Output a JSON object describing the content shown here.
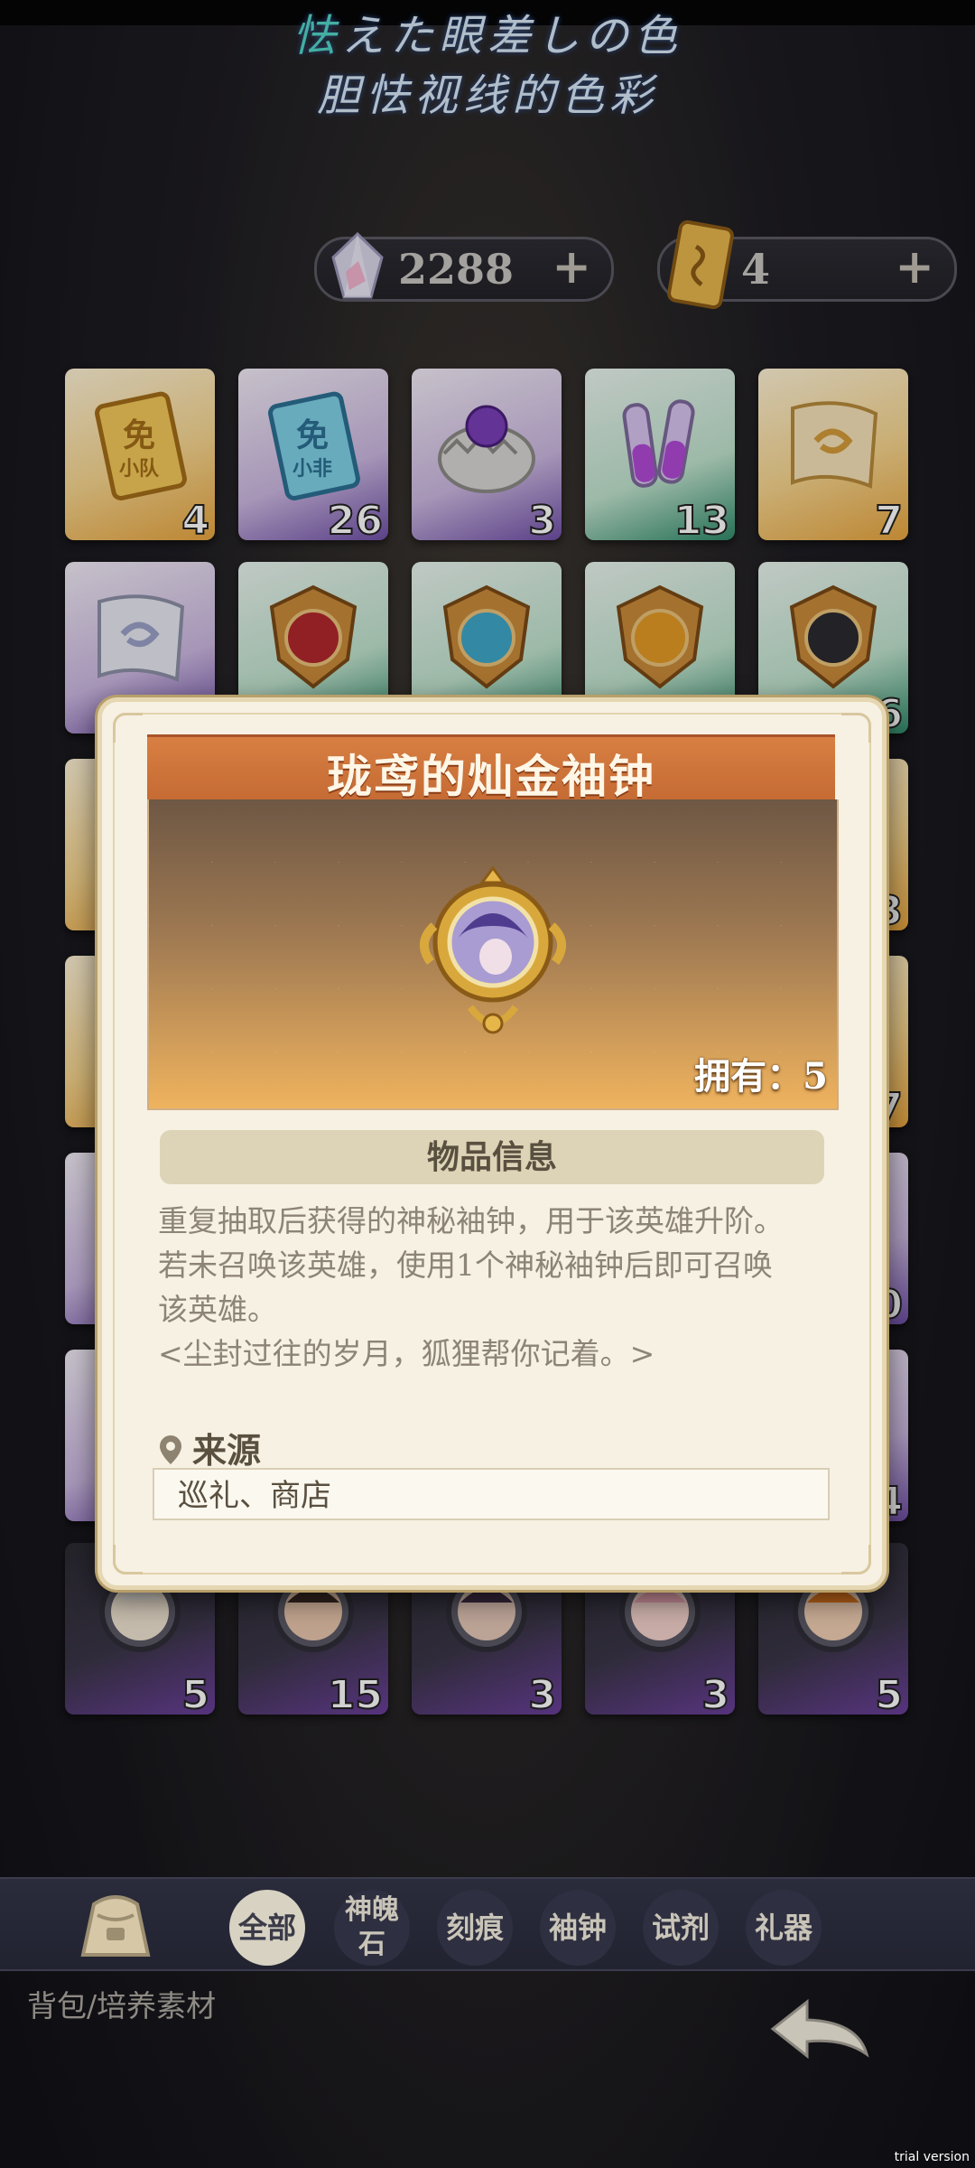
{
  "lyrics": {
    "line1_accent": "怯",
    "line1_rest": "えた眼差しの色",
    "line2": "胆怯视线的色彩"
  },
  "currencies": [
    {
      "name": "crystal",
      "value": "2288",
      "plus": "+"
    },
    {
      "name": "ticket",
      "value": "4",
      "plus": "+"
    }
  ],
  "grid": {
    "row1": [
      {
        "count": "4",
        "rarity": "gold",
        "icon": "ticket-icon",
        "label": "免\n小队"
      },
      {
        "count": "26",
        "rarity": "purple",
        "icon": "ticket-icon",
        "label": "免\n小非"
      },
      {
        "count": "3",
        "rarity": "purple",
        "icon": "egg-icon"
      },
      {
        "count": "13",
        "rarity": "green",
        "icon": "potion-icon"
      },
      {
        "count": "7",
        "rarity": "gold",
        "icon": "scroll-icon"
      }
    ],
    "row2": [
      {
        "count": "",
        "rarity": "purple",
        "icon": "scroll-icon"
      },
      {
        "count": "",
        "rarity": "green",
        "icon": "badge-icon"
      },
      {
        "count": "",
        "rarity": "green",
        "icon": "badge-icon"
      },
      {
        "count": "",
        "rarity": "green",
        "icon": "badge-icon"
      },
      {
        "count": "6",
        "rarity": "green",
        "icon": "badge-icon"
      }
    ],
    "right_counts": [
      "3",
      "7",
      "0",
      "4"
    ],
    "bottom_row": [
      {
        "count": "5",
        "icon": "hero-bell-icon"
      },
      {
        "count": "15",
        "icon": "hero-bell-icon"
      },
      {
        "count": "3",
        "icon": "hero-bell-icon"
      },
      {
        "count": "3",
        "icon": "hero-bell-icon"
      },
      {
        "count": "5",
        "icon": "hero-bell-icon"
      }
    ]
  },
  "modal": {
    "title": "珑鸢的灿金袖钟",
    "owned": "拥有：5",
    "section_header": "物品信息",
    "description": [
      "重复抽取后获得的神秘袖钟，用于该英雄升阶。",
      "若未召唤该英雄，使用1个神秘袖钟后即可召唤",
      "该英雄。",
      "<尘封过往的岁月，狐狸帮你记着。>"
    ],
    "source_label": "来源",
    "source_value": "巡礼、商店"
  },
  "tabs": [
    {
      "label": "全部",
      "active": true
    },
    {
      "label": "神魄\n石",
      "active": false
    },
    {
      "label": "刻痕",
      "active": false
    },
    {
      "label": "袖钟",
      "active": false
    },
    {
      "label": "试剂",
      "active": false
    },
    {
      "label": "礼器",
      "active": false
    }
  ],
  "breadcrumb": "背包/培养素材",
  "watermark": "trial version",
  "colors": {
    "accent_orange": "#c96c34",
    "panel_cream": "#f7f1e3",
    "tab_active": "#d8d2c3"
  }
}
